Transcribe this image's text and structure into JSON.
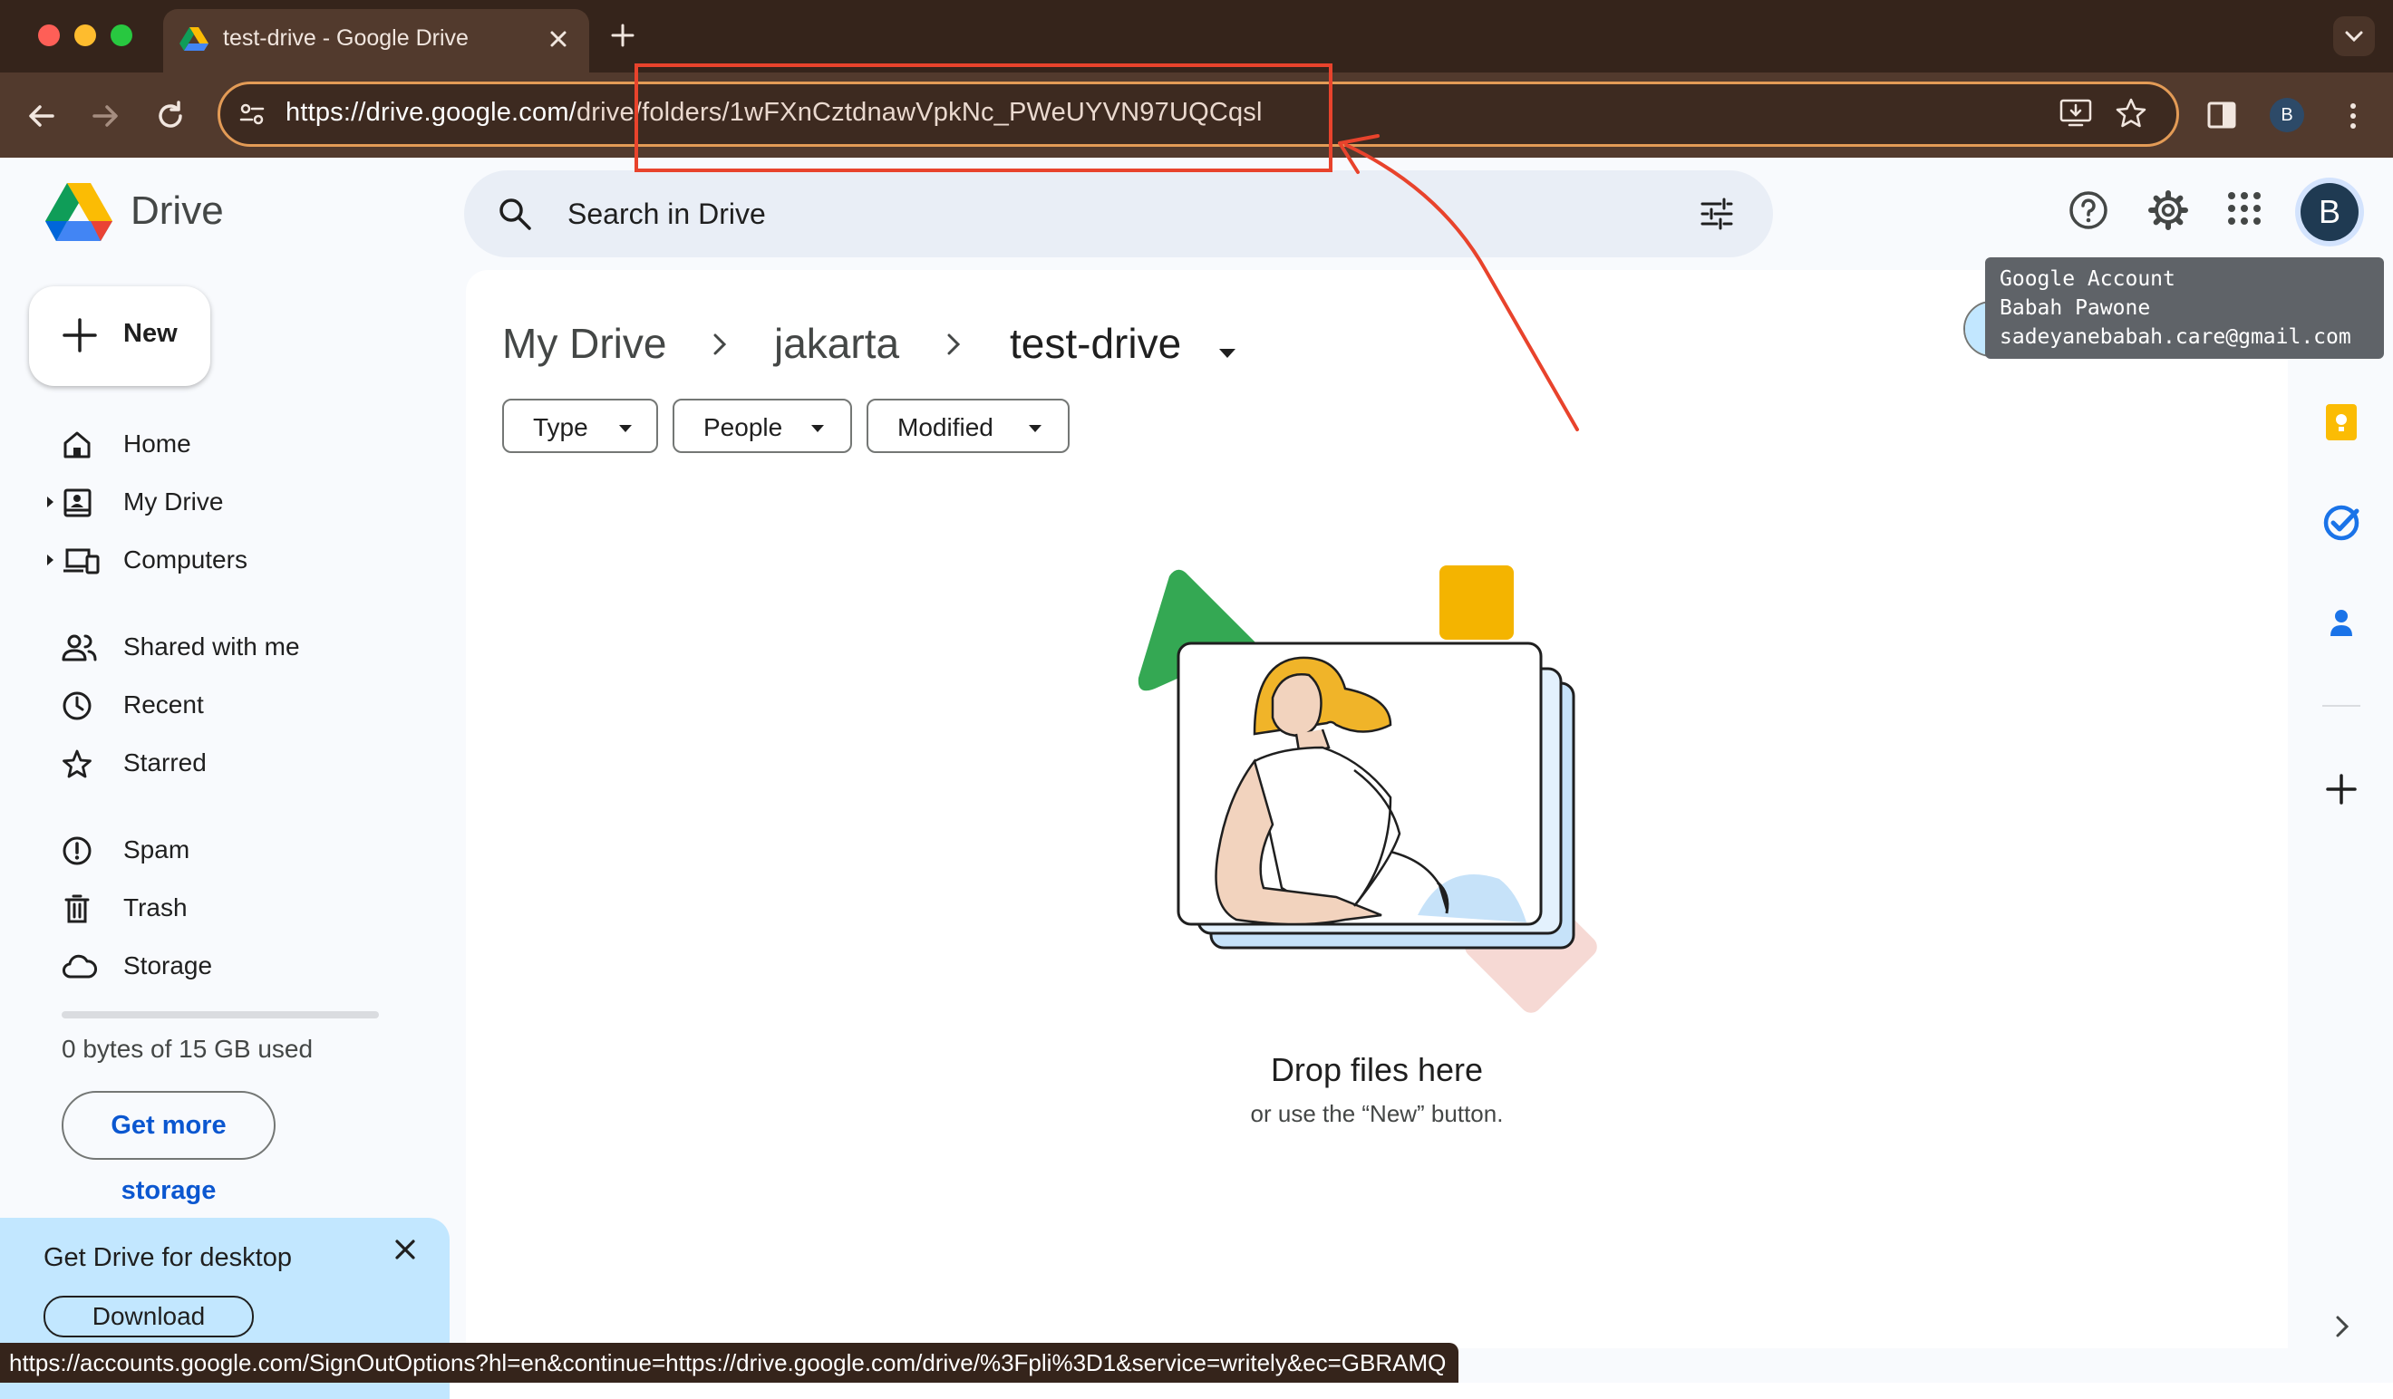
{
  "browser": {
    "tab_title": "test-drive - Google Drive",
    "url_host": "https://drive.google.com/",
    "url_path": "drive/folders/1wFXnCztdnawVpkNc_PWeUYVN97UQCqsl",
    "profile_initial": "B",
    "status_url": "https://accounts.google.com/SignOutOptions?hl=en&continue=https://drive.google.com/drive/%3Fpli%3D1&service=writely&ec=GBRAMQ"
  },
  "header": {
    "app_name": "Drive",
    "search_placeholder": "Search in Drive",
    "avatar_initial": "B",
    "icons": [
      "help-icon",
      "settings-icon",
      "apps-grid-icon",
      "search-options-icon"
    ]
  },
  "account_tooltip": {
    "title": "Google Account",
    "name": "Babah Pawone",
    "email": "sadeyanebabah.care@gmail.com"
  },
  "sidebar": {
    "new_label": "New",
    "items": [
      {
        "label": "Home",
        "icon": "home-icon"
      },
      {
        "label": "My Drive",
        "icon": "my-drive-icon"
      },
      {
        "label": "Computers",
        "icon": "computers-icon"
      },
      {
        "label": "Shared with me",
        "icon": "shared-icon"
      },
      {
        "label": "Recent",
        "icon": "clock-icon"
      },
      {
        "label": "Starred",
        "icon": "star-icon"
      },
      {
        "label": "Spam",
        "icon": "spam-icon"
      },
      {
        "label": "Trash",
        "icon": "trash-icon"
      },
      {
        "label": "Storage",
        "icon": "cloud-icon"
      }
    ],
    "storage_used_text": "0 bytes of 15 GB used",
    "storage_used_fraction": 0,
    "get_storage_label": "Get more storage"
  },
  "promo": {
    "title": "Get Drive for desktop",
    "download_label": "Download"
  },
  "main": {
    "breadcrumb": [
      "My Drive",
      "jakarta",
      "test-drive"
    ],
    "filters": [
      "Type",
      "People",
      "Modified"
    ],
    "empty_title": "Drop files here",
    "empty_subtitle": "or use the “New” button."
  },
  "right_panel": {
    "icons": [
      "calendar-icon",
      "keep-icon",
      "tasks-icon",
      "contacts-icon",
      "add-icon"
    ]
  },
  "colors": {
    "chrome_dark": "#35241b",
    "chrome_toolbar": "#523a2d",
    "omnibox_border": "#e39b56",
    "app_bg": "#f8fafd",
    "accent_blue": "#0b57d0",
    "annotation_red": "#e8432c"
  }
}
